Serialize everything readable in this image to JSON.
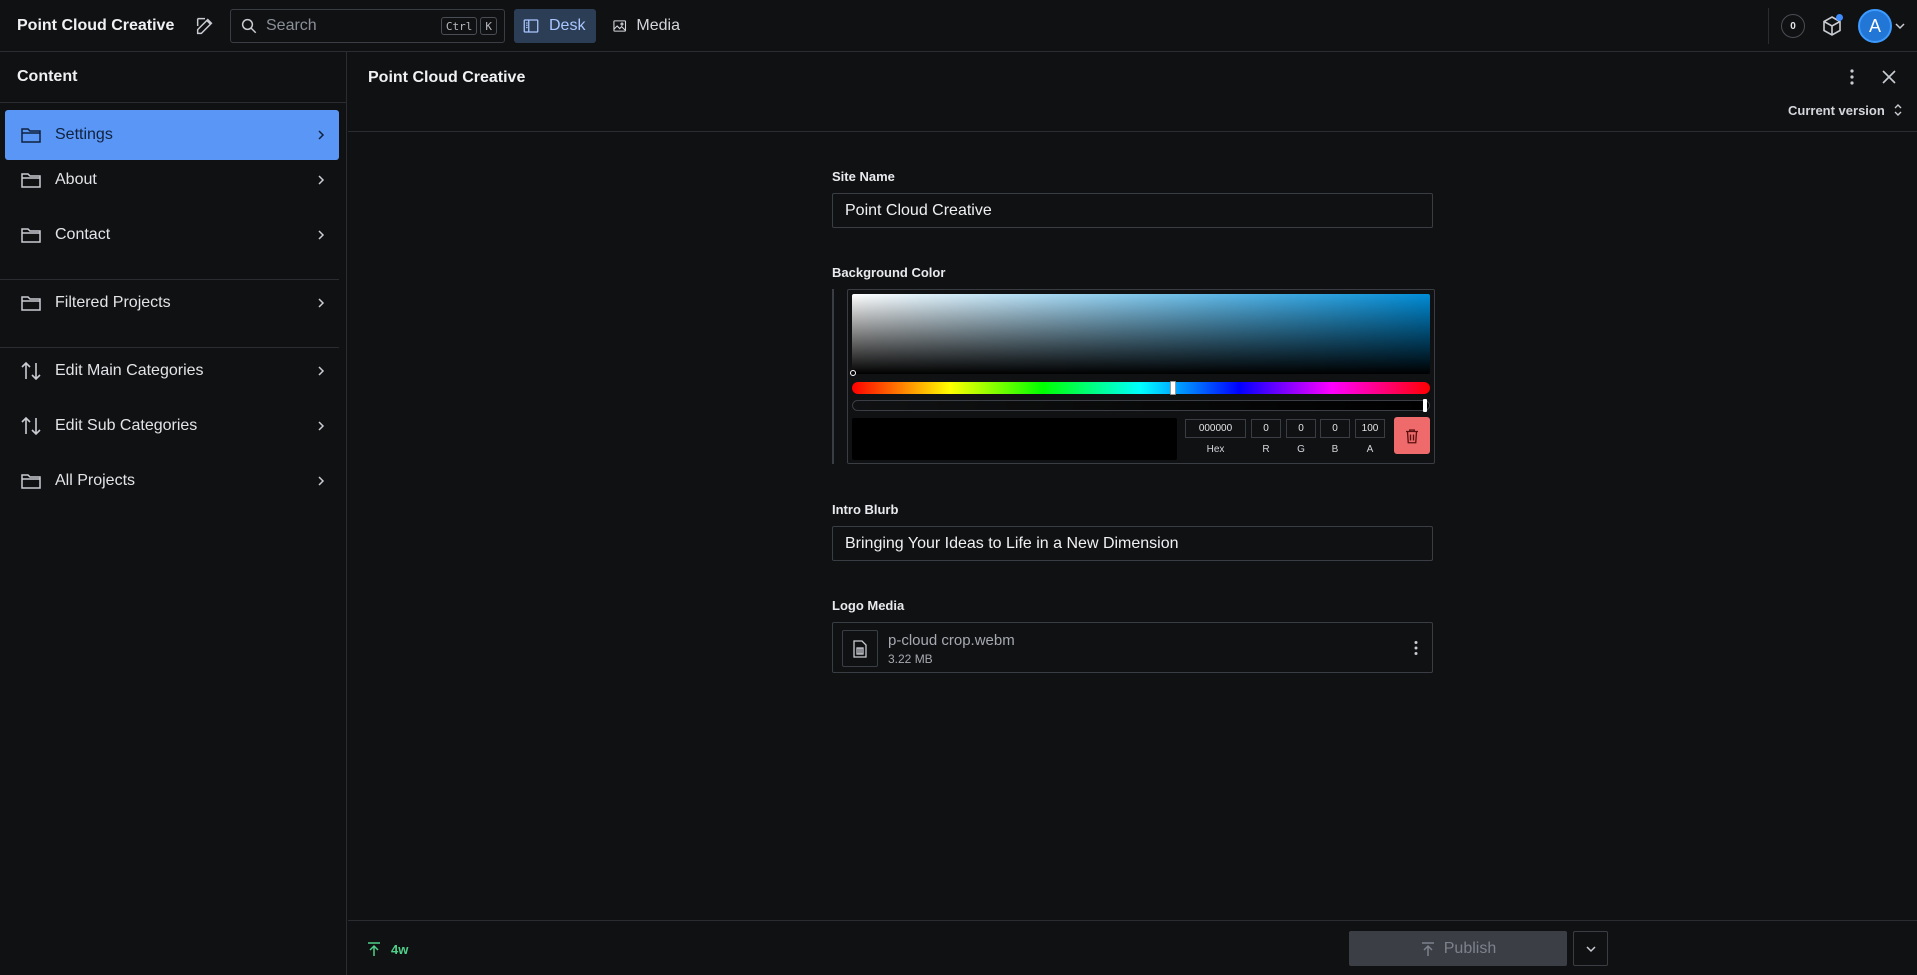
{
  "app": {
    "title": "Point Cloud Creative"
  },
  "search": {
    "placeholder": "Search",
    "shortcut_ctrl": "Ctrl",
    "shortcut_key": "K"
  },
  "nav": {
    "desk": "Desk",
    "media": "Media"
  },
  "header": {
    "notifications": "0",
    "avatar_initial": "A"
  },
  "sidebar": {
    "title": "Content",
    "items": [
      {
        "label": "Settings",
        "icon": "folder-icon",
        "active": true
      },
      {
        "label": "About",
        "icon": "folder-icon"
      },
      {
        "label": "Contact",
        "icon": "folder-icon"
      },
      {
        "label": "Filtered Projects",
        "icon": "folder-icon"
      },
      {
        "label": "Edit Main Categories",
        "icon": "sort-arrows-icon"
      },
      {
        "label": "Edit Sub Categories",
        "icon": "sort-arrows-icon"
      },
      {
        "label": "All Projects",
        "icon": "folder-icon"
      }
    ]
  },
  "document": {
    "title": "Point Cloud Creative",
    "version": "Current version",
    "fields": {
      "site_name": {
        "label": "Site Name",
        "value": "Point Cloud Creative"
      },
      "background_color": {
        "label": "Background Color",
        "hex": "000000",
        "r": "0",
        "g": "0",
        "b": "0",
        "a": "100",
        "hex_label": "Hex",
        "r_label": "R",
        "g_label": "G",
        "b_label": "B",
        "a_label": "A"
      },
      "intro_blurb": {
        "label": "Intro Blurb",
        "value": "Bringing Your Ideas to Life in a New Dimension"
      },
      "logo_media": {
        "label": "Logo Media",
        "file_name": "p-cloud crop.webm",
        "file_size": "3.22 MB"
      }
    }
  },
  "footer": {
    "status": "4w",
    "publish_label": "Publish"
  },
  "colors": {
    "accent": "#5a96f5",
    "status": "#4fd08a",
    "delete": "#ef6b6b",
    "avatar": "#2277d6"
  }
}
